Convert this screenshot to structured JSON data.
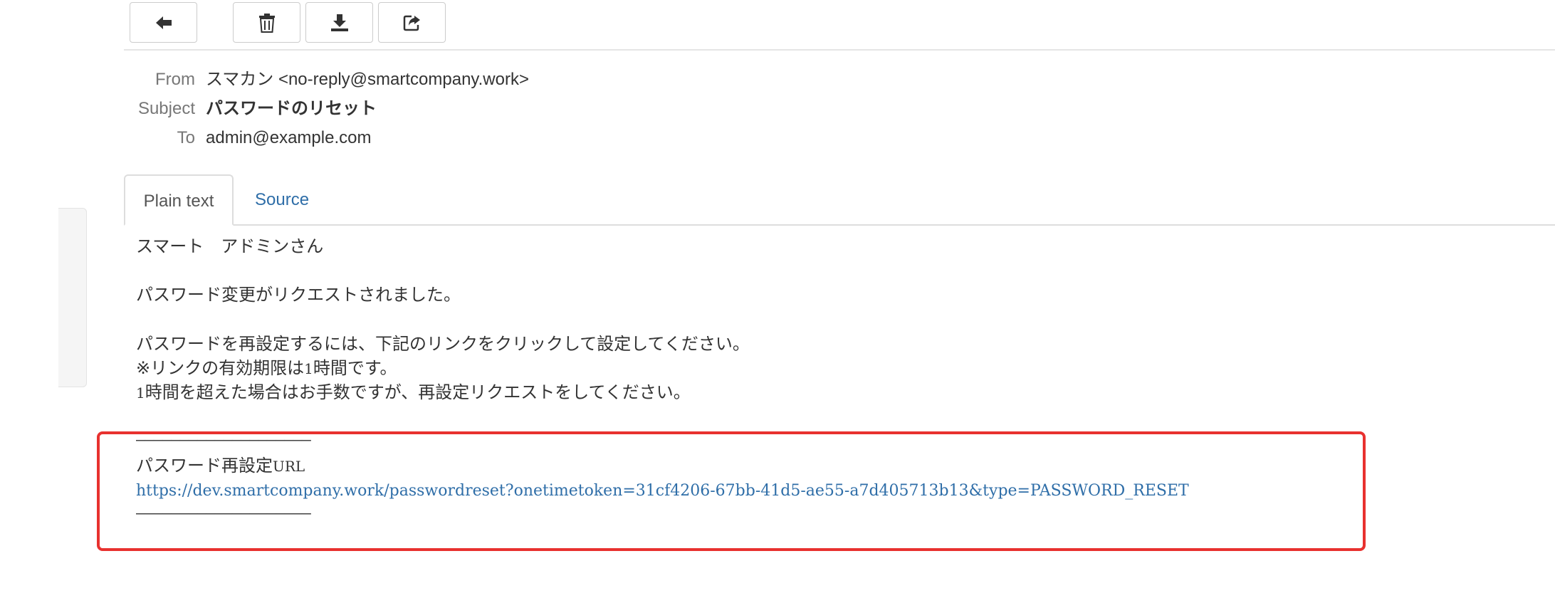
{
  "toolbar": {
    "buttons": [
      {
        "name": "back",
        "icon": "arrow-left-icon"
      },
      {
        "name": "delete",
        "icon": "trash-icon"
      },
      {
        "name": "download",
        "icon": "download-icon"
      },
      {
        "name": "forward",
        "icon": "share-icon"
      }
    ]
  },
  "headers": {
    "from_label": "From",
    "from_value": "スマカン <no-reply@smartcompany.work>",
    "subject_label": "Subject",
    "subject_value": "パスワードのリセット",
    "to_label": "To",
    "to_value": "admin@example.com"
  },
  "tabs": {
    "plain_text": "Plain text",
    "source": "Source"
  },
  "message": {
    "greeting": "スマート　アドミンさん",
    "line1": "パスワード変更がリクエストされました。",
    "line2": "パスワードを再設定するには、下記のリンクをクリックして設定してください。",
    "line3_prefix": "※リンクの有効期限は",
    "line3_num": "1",
    "line3_suffix": "時間です。",
    "line4_num": "1",
    "line4_suffix": "時間を超えた場合はお手数ですが、再設定リクエストをしてください。",
    "separator": "――――――――――――――――――――",
    "url_label_prefix": "パスワード再設定",
    "url_label_suffix": "URL",
    "reset_url": "https://dev.smartcompany.work/passwordreset?onetimetoken=31cf4206-67bb-41d5-ae55-a7d405713b13&type=PASSWORD_RESET"
  },
  "colors": {
    "link": "#2f6ea8",
    "highlight": "#e8312f"
  }
}
